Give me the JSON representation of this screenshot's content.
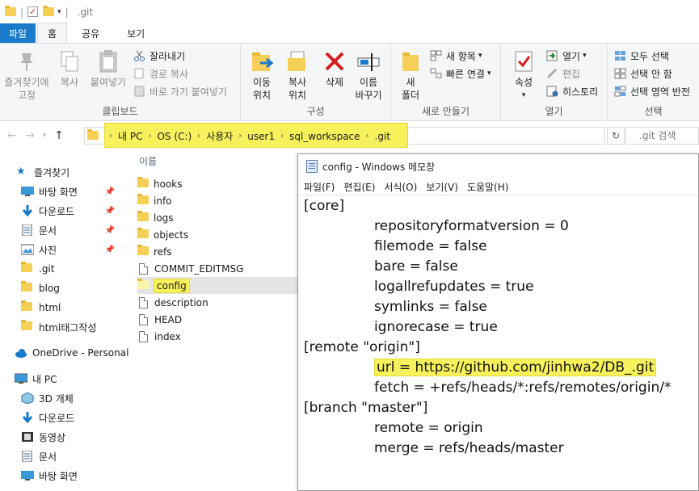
{
  "titlebar": {
    "title": ".git"
  },
  "tabs": [
    "파일",
    "홈",
    "공유",
    "보기"
  ],
  "ribbon": {
    "clipboard": {
      "group_label": "클립보드",
      "pin_quick": "즐겨찾기에\n고정",
      "copy": "복사",
      "paste": "붙여넣기",
      "cut": "잘라내기",
      "copy_path": "경로 복사",
      "paste_shortcut": "바로 가기 붙여넣기"
    },
    "organize": {
      "group_label": "구성",
      "move_to": "이동\n위치",
      "copy_to": "복사\n위치",
      "delete": "삭제",
      "rename": "이름\n바꾸기"
    },
    "new": {
      "group_label": "새로 만들기",
      "new_folder": "새\n폴더",
      "new_item": "새 항목",
      "easy_access": "빠른 연결"
    },
    "open": {
      "group_label": "열기",
      "properties": "속성",
      "open": "열기",
      "edit": "편집",
      "history": "히스토리"
    },
    "select": {
      "group_label": "선택",
      "select_all": "모두 선택",
      "select_none": "선택 안 함",
      "invert": "선택 영역 반전"
    }
  },
  "address": {
    "crumbs": [
      "내 PC",
      "OS (C:)",
      "사용자",
      "user1",
      "sql_workspace",
      ".git"
    ],
    "search_placeholder": ".git 검색"
  },
  "nav": {
    "quick_access": "즐겨찾기",
    "items": [
      "바탕 화면",
      "다운로드",
      "문서",
      "사진",
      ".git",
      "blog",
      "html",
      "html태그작성"
    ],
    "onedrive": "OneDrive - Personal",
    "this_pc": "내 PC",
    "pc_items": [
      "3D 개체",
      "다운로드",
      "동영상",
      "문서",
      "바탕 화면"
    ]
  },
  "files": {
    "column_name": "이름",
    "folders": [
      "hooks",
      "info",
      "logs",
      "objects",
      "refs"
    ],
    "docs": [
      "COMMIT_EDITMSG",
      "config",
      "description",
      "HEAD",
      "index"
    ],
    "selected": "config"
  },
  "notepad": {
    "title": "config - Windows 메모장",
    "menu": [
      "파일(F)",
      "편집(E)",
      "서식(O)",
      "보기(V)",
      "도움말(H)"
    ],
    "lines": [
      {
        "text": "[core]",
        "indent": false
      },
      {
        "text": "repositoryformatversion = 0",
        "indent": true
      },
      {
        "text": "filemode = false",
        "indent": true
      },
      {
        "text": "bare = false",
        "indent": true
      },
      {
        "text": "logallrefupdates = true",
        "indent": true
      },
      {
        "text": "symlinks = false",
        "indent": true
      },
      {
        "text": "ignorecase = true",
        "indent": true
      },
      {
        "text": "[remote \"origin\"]",
        "indent": false
      },
      {
        "text": "url = https://github.com/jinhwa2/DB_.git",
        "indent": true,
        "highlight": true
      },
      {
        "text": "fetch = +refs/heads/*:refs/remotes/origin/*",
        "indent": true
      },
      {
        "text": "[branch \"master\"]",
        "indent": false
      },
      {
        "text": "remote = origin",
        "indent": true
      },
      {
        "text": "merge = refs/heads/master",
        "indent": true
      }
    ]
  },
  "colors": {
    "accent": "#1979ca",
    "highlight": "#f7f25c",
    "folder": "#f6cf57"
  }
}
